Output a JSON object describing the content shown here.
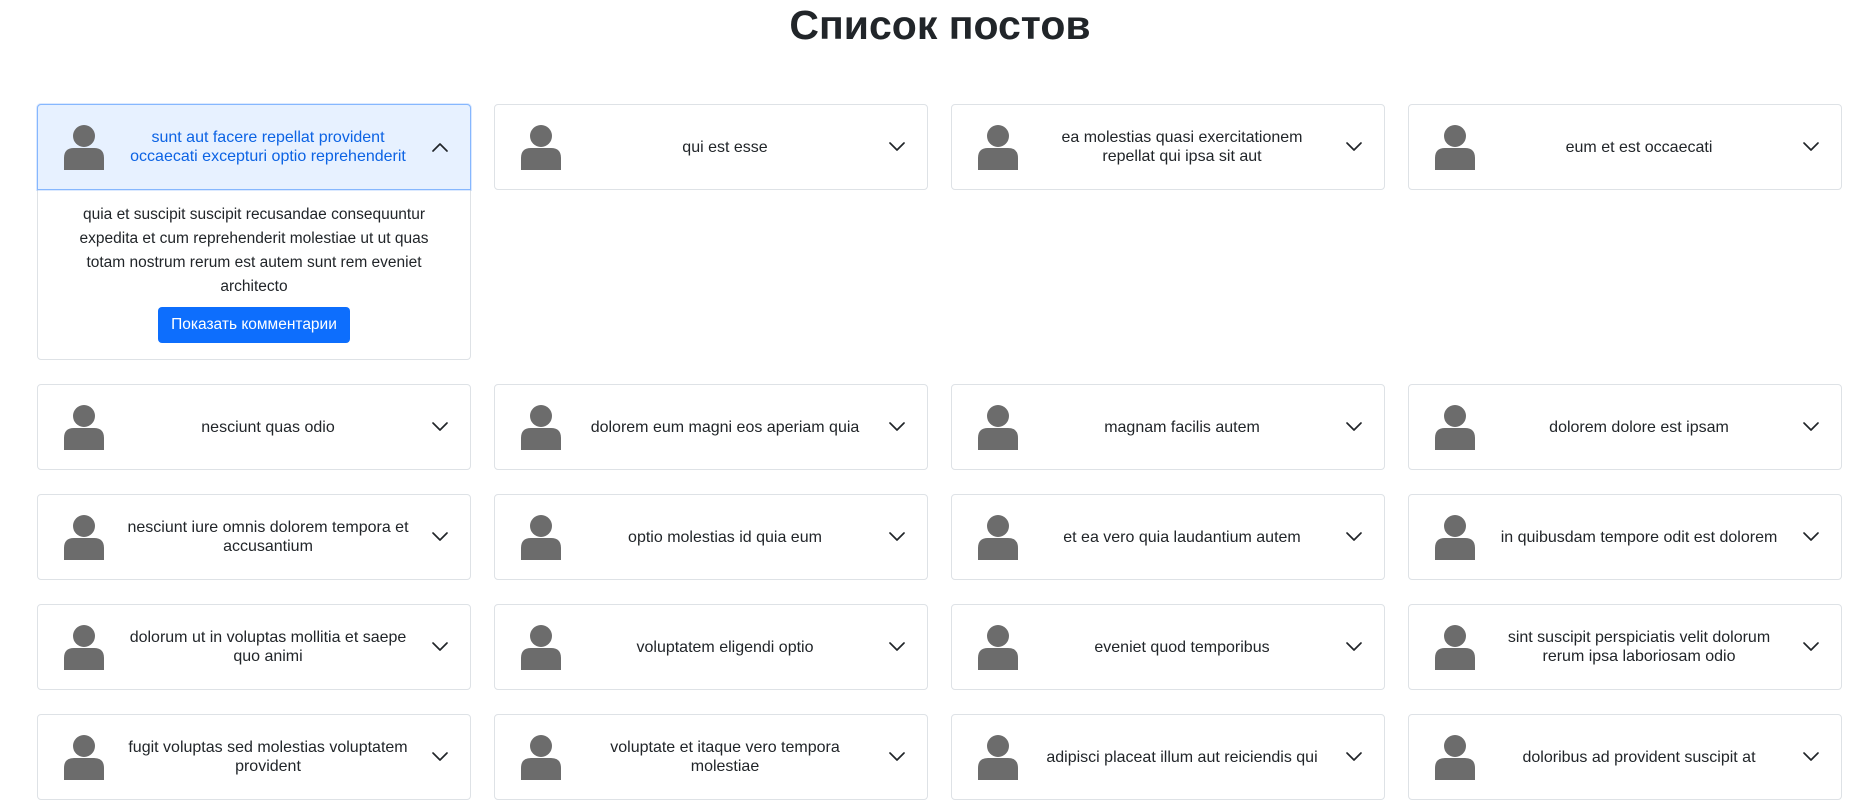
{
  "page": {
    "title": "Список постов"
  },
  "colors": {
    "accent": "#0d6efd",
    "expanded_header_bg": "#e7f1ff",
    "avatar": "#6c6c6c",
    "border": "#dee2e6"
  },
  "icons": {
    "avatar": "user-silhouette-icon",
    "collapsed": "chevron-down-icon",
    "expanded": "chevron-up-icon"
  },
  "posts": [
    {
      "title": "sunt aut facere repellat provident occaecati excepturi optio reprehenderit",
      "expanded": true,
      "body": "quia et suscipit suscipit recusandae consequuntur expedita et cum reprehenderit molestiae ut ut quas totam nostrum rerum est autem sunt rem eveniet architecto",
      "button_label": "Показать комментарии"
    },
    {
      "title": "qui est esse",
      "expanded": false
    },
    {
      "title": "ea molestias quasi exercitationem repellat qui ipsa sit aut",
      "expanded": false
    },
    {
      "title": "eum et est occaecati",
      "expanded": false
    },
    {
      "title": "nesciunt quas odio",
      "expanded": false
    },
    {
      "title": "dolorem eum magni eos aperiam quia",
      "expanded": false
    },
    {
      "title": "magnam facilis autem",
      "expanded": false
    },
    {
      "title": "dolorem dolore est ipsam",
      "expanded": false
    },
    {
      "title": "nesciunt iure omnis dolorem tempora et accusantium",
      "expanded": false
    },
    {
      "title": "optio molestias id quia eum",
      "expanded": false
    },
    {
      "title": "et ea vero quia laudantium autem",
      "expanded": false
    },
    {
      "title": "in quibusdam tempore odit est dolorem",
      "expanded": false
    },
    {
      "title": "dolorum ut in voluptas mollitia et saepe quo animi",
      "expanded": false
    },
    {
      "title": "voluptatem eligendi optio",
      "expanded": false
    },
    {
      "title": "eveniet quod temporibus",
      "expanded": false
    },
    {
      "title": "sint suscipit perspiciatis velit dolorum rerum ipsa laboriosam odio",
      "expanded": false
    },
    {
      "title": "fugit voluptas sed molestias voluptatem provident",
      "expanded": false
    },
    {
      "title": "voluptate et itaque vero tempora molestiae",
      "expanded": false
    },
    {
      "title": "adipisci placeat illum aut reiciendis qui",
      "expanded": false
    },
    {
      "title": "doloribus ad provident suscipit at",
      "expanded": false
    }
  ]
}
